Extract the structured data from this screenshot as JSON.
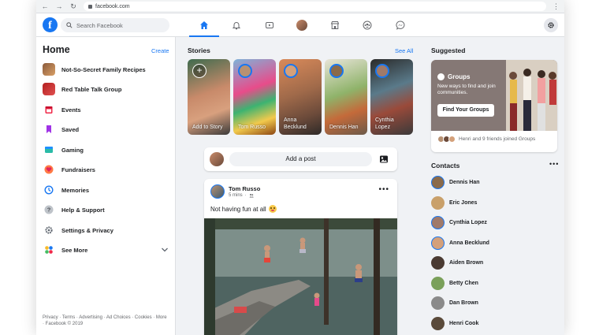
{
  "browser": {
    "url": "facebook.com"
  },
  "header": {
    "search_placeholder": "Search Facebook",
    "tabs": [
      "home-icon",
      "notifications-bell-icon",
      "watch-icon",
      "profile-avatar",
      "marketplace-icon",
      "groups-icon",
      "messenger-icon"
    ],
    "accent": "#1877f2"
  },
  "sidebar": {
    "title": "Home",
    "create": "Create",
    "items": [
      {
        "label": "Not-So-Secret Family Recipes",
        "icon": "group-thumbnail"
      },
      {
        "label": "Red Table Talk Group",
        "icon": "group-thumbnail"
      },
      {
        "label": "Events",
        "icon": "calendar-icon"
      },
      {
        "label": "Saved",
        "icon": "bookmark-icon"
      },
      {
        "label": "Gaming",
        "icon": "gaming-icon"
      },
      {
        "label": "Fundraisers",
        "icon": "heart-icon"
      },
      {
        "label": "Memories",
        "icon": "clock-icon"
      },
      {
        "label": "Help & Support",
        "icon": "question-icon"
      },
      {
        "label": "Settings & Privacy",
        "icon": "gear-icon"
      },
      {
        "label": "See More",
        "icon": "grid-icon"
      }
    ],
    "footer": "Privacy · Terms · Advertising · Ad Choices · Cookies · More · Facebook © 2019"
  },
  "stories": {
    "title": "Stories",
    "see_all": "See All",
    "items": [
      {
        "name": "Add to Story"
      },
      {
        "name": "Tom Russo"
      },
      {
        "name": "Anna Becklund"
      },
      {
        "name": "Dennis Han"
      },
      {
        "name": "Cynthia Lopez"
      }
    ]
  },
  "composer": {
    "placeholder": "Add a post"
  },
  "post": {
    "author": "Tom Russo",
    "time": "5 mins",
    "text": "Not having fun at all"
  },
  "suggested": {
    "title": "Suggested",
    "card_title": "Groups",
    "card_desc": "New ways to find and join communities.",
    "button": "Find Your Groups",
    "footer": "Henri and 9 friends joined Groups"
  },
  "contacts": {
    "title": "Contacts",
    "list": [
      "Dennis Han",
      "Eric Jones",
      "Cynthia Lopez",
      "Anna Becklund",
      "Aiden Brown",
      "Betty Chen",
      "Dan Brown",
      "Henri Cook"
    ]
  }
}
